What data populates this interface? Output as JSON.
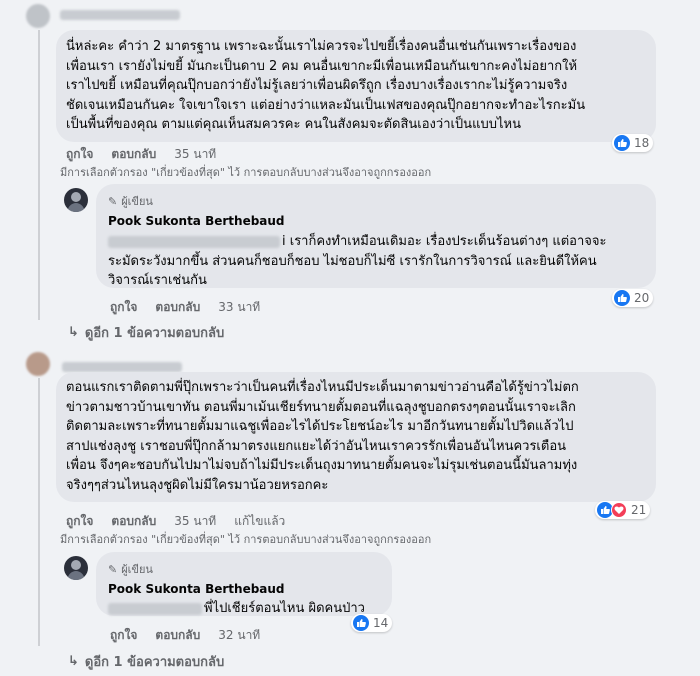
{
  "comments": [
    {
      "text": "นี่หล่ะคะ คำว่า 2 มาตรฐาน เพราะฉะนั้นเราไม่ควรจะไปขยี้เรื่องคนอื่นเช่นกันเพราะเรื่องของ\nเพื่อนเรา เรายังไม่ขยี้ มันกะเป็นดาบ 2 คม คนอื่นเขากะมีเพื่อนเหมือนกันเขากะคงไม่อยากให้\nเราไปขยี้ เหมือนที่คุณปุ๊กบอกว่ายังไม่รู้เลยว่าเพื่อนผิดรึถูก เรื่องบางเรื่องเรากะไม่รู้ความจริง\nชัดเจนเหมือนกันคะ ใจเขาใจเรา แต่อย่างว่าแหละมันเป็นเฟสของคุณปุ๊กอยากจะทำอะไรกะมัน\nเป็นพื้นที่ของคุณ ตามแต่คุณเห็นสมควรคะ คนในสังคมจะตัดสินเองว่าเป็นแบบไหน",
      "like": "ถูกใจ",
      "reply": "ตอบกลับ",
      "time": "35 นาที",
      "reactions": "18",
      "filter_note": "มีการเลือกตัวกรอง \"เกี่ยวข้องที่สุด\" ไว้ การตอบกลับบางส่วนจึงอาจถูกกรองออก",
      "reply_item": {
        "author_tag": "ผู้เขียน",
        "author": "Pook Sukonta Berthebaud",
        "text_first": "i เราก็คงทำเหมือนเดิมอะ เรื่องประเด็นร้อนต่างๆ แต่อาจจะ",
        "text_rest": "ระมัดระวังมากขึ้น ส่วนคนก็ชอบก็ชอบ ไม่ชอบก็ไม่ซี เรารักในการวิจารณ์ และยินดีให้คน\nวิจารณ์เราเช่นกัน",
        "like": "ถูกใจ",
        "reply": "ตอบกลับ",
        "time": "33 นาที",
        "reactions": "20"
      },
      "more_replies": "ดูอีก 1 ข้อความตอบกลับ"
    },
    {
      "text": "ตอนแรกเราติดตามพี่ปุ๊กเพราะว่าเป็นคนที่เรื่องไหนมีประเด็นมาตามข่าวอ่านคือได้รู้ข่าวไม่ตก\nข่าวตามชาวบ้านเขาทัน ตอนพี่มาเม้นเชียร์ทนายตั้มตอนที่แฉลุงชูบอกตรงๆตอนนั้นเราจะเลิก\nติดตามละเพราะที่ทนายตั้มมาแฉชูเพื่ออะไรได้ประโยชน์อะไร มาอีกวันทนายตั้มไปวิดแล้วไป\nสาปแช่งลุงชู เราชอบพี่ปุ๊กกล้ามาตรงแยกแยะได้ว่าอันไหนเราควรรักเพื่อนอันไหนควรเตือน\nเพื่อน จึงๆคะชอบกันไปมาไม่จบถ้าไม่มีประเด็นถุงมาทนายตั้มคนจะไม่รุมเช่นตอนนี้มันลามทุ่ง\nจริงๆๆส่วนไหนลุงชูผิดไม่มีใครมาน้อวยหรอกคะ",
      "like": "ถูกใจ",
      "reply": "ตอบกลับ",
      "time": "35 นาที",
      "edited": "แก้ไขแล้ว",
      "reactions": "21",
      "filter_note": "มีการเลือกตัวกรอง \"เกี่ยวข้องที่สุด\" ไว้ การตอบกลับบางส่วนจึงอาจถูกกรองออก",
      "reply_item": {
        "author_tag": "ผู้เขียน",
        "author": "Pook Sukonta Berthebaud",
        "text_first": "พี่ไปเชียร์ตอนไหน ผิดคนป่าว",
        "like": "ถูกใจ",
        "reply": "ตอบกลับ",
        "time": "32 นาที",
        "reactions": "14"
      },
      "more_replies": "ดูอีก 1 ข้อความตอบกลับ"
    }
  ],
  "colors": {
    "bg": "#f0f2f5",
    "bubble": "#e4e6eb",
    "meta": "#65676b",
    "like": "#1877f2",
    "love": "#f33e58"
  }
}
